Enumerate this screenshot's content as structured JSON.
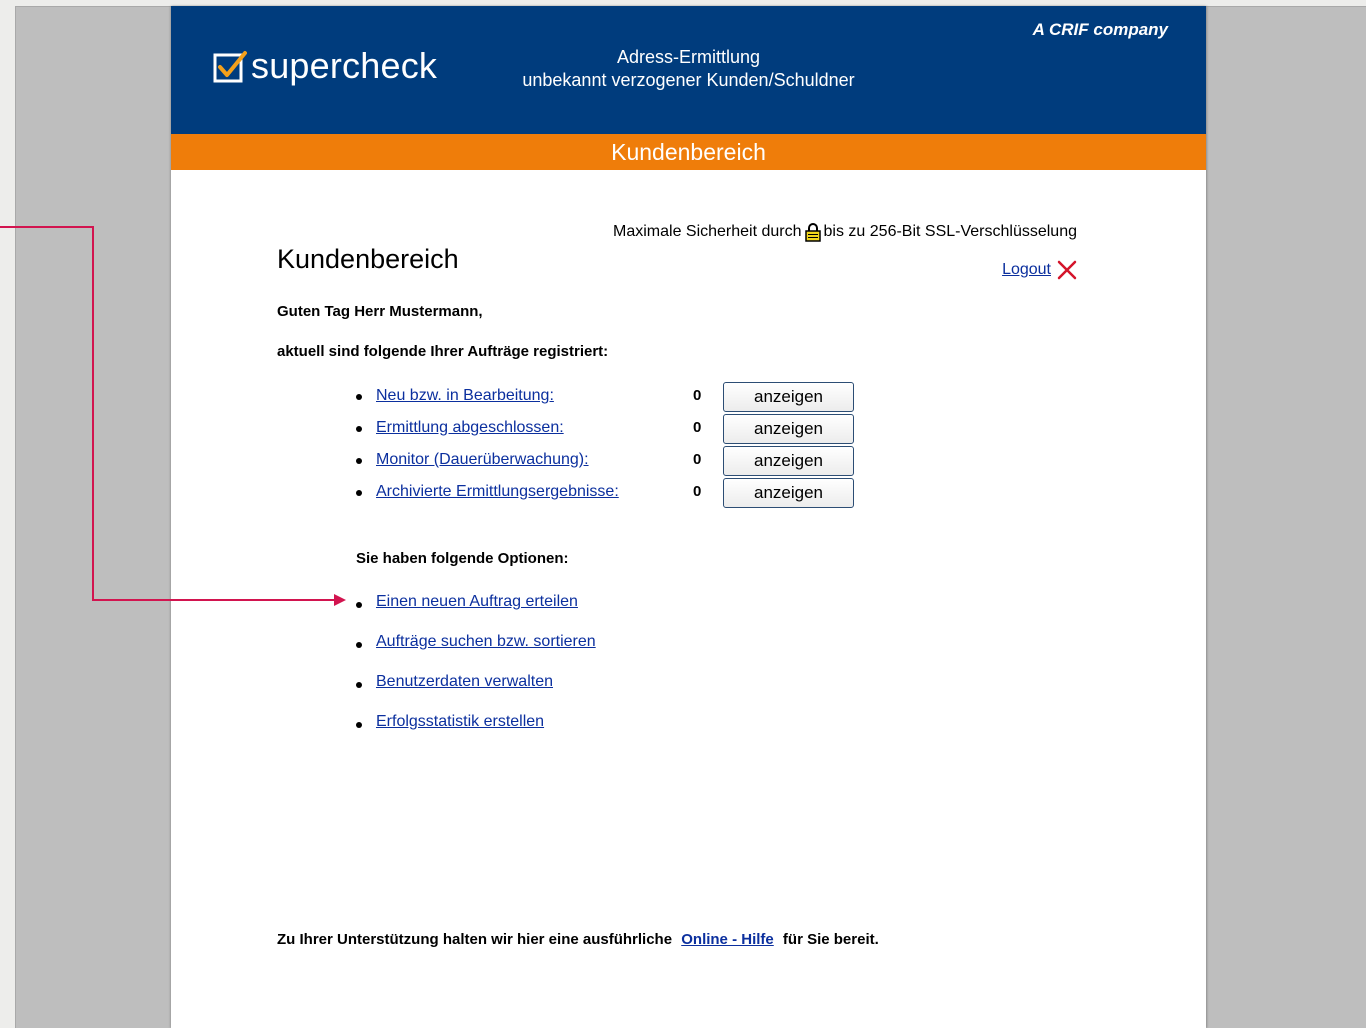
{
  "header": {
    "logo_text": "supercheck",
    "title_line1": "Adress-Ermittlung",
    "title_line2": "unbekannt verzogener Kunden/Schuldner",
    "crif": "A CRIF company"
  },
  "section_bar": "Kundenbereich",
  "ssl": {
    "before": "Maximale Sicherheit durch",
    "after": "bis zu 256-Bit SSL-Verschlüsselung"
  },
  "logout": "Logout",
  "main_title": "Kundenbereich",
  "greeting": "Guten Tag Herr Mustermann,",
  "intro": "aktuell sind folgende Ihrer Aufträge registriert:",
  "orders": [
    {
      "label": "Neu bzw. in Bearbeitung:",
      "count": "0",
      "button": "anzeigen"
    },
    {
      "label": "Ermittlung abgeschlossen:",
      "count": "0",
      "button": "anzeigen"
    },
    {
      "label": "Monitor (Dauerüberwachung):",
      "count": "0",
      "button": "anzeigen"
    },
    {
      "label": "Archivierte Ermittlungsergebnisse:",
      "count": "0",
      "button": "anzeigen"
    }
  ],
  "options_title": "Sie haben folgende Optionen:",
  "options": [
    "Einen neuen Auftrag erteilen",
    "Aufträge suchen bzw. sortieren",
    "Benutzerdaten verwalten",
    "Erfolgsstatistik erstellen"
  ],
  "footer": {
    "before": "Zu Ihrer Unterstützung halten wir hier eine ausführliche",
    "link": "Online - Hilfe",
    "after": "für Sie bereit."
  },
  "colors": {
    "header": "#003c7d",
    "orange": "#ef7d0a",
    "link": "#0b2f9e",
    "annotation": "#d2144f"
  },
  "icons": [
    "checkbox-logo-icon",
    "lock-icon",
    "close-icon",
    "arrow-right-icon"
  ]
}
